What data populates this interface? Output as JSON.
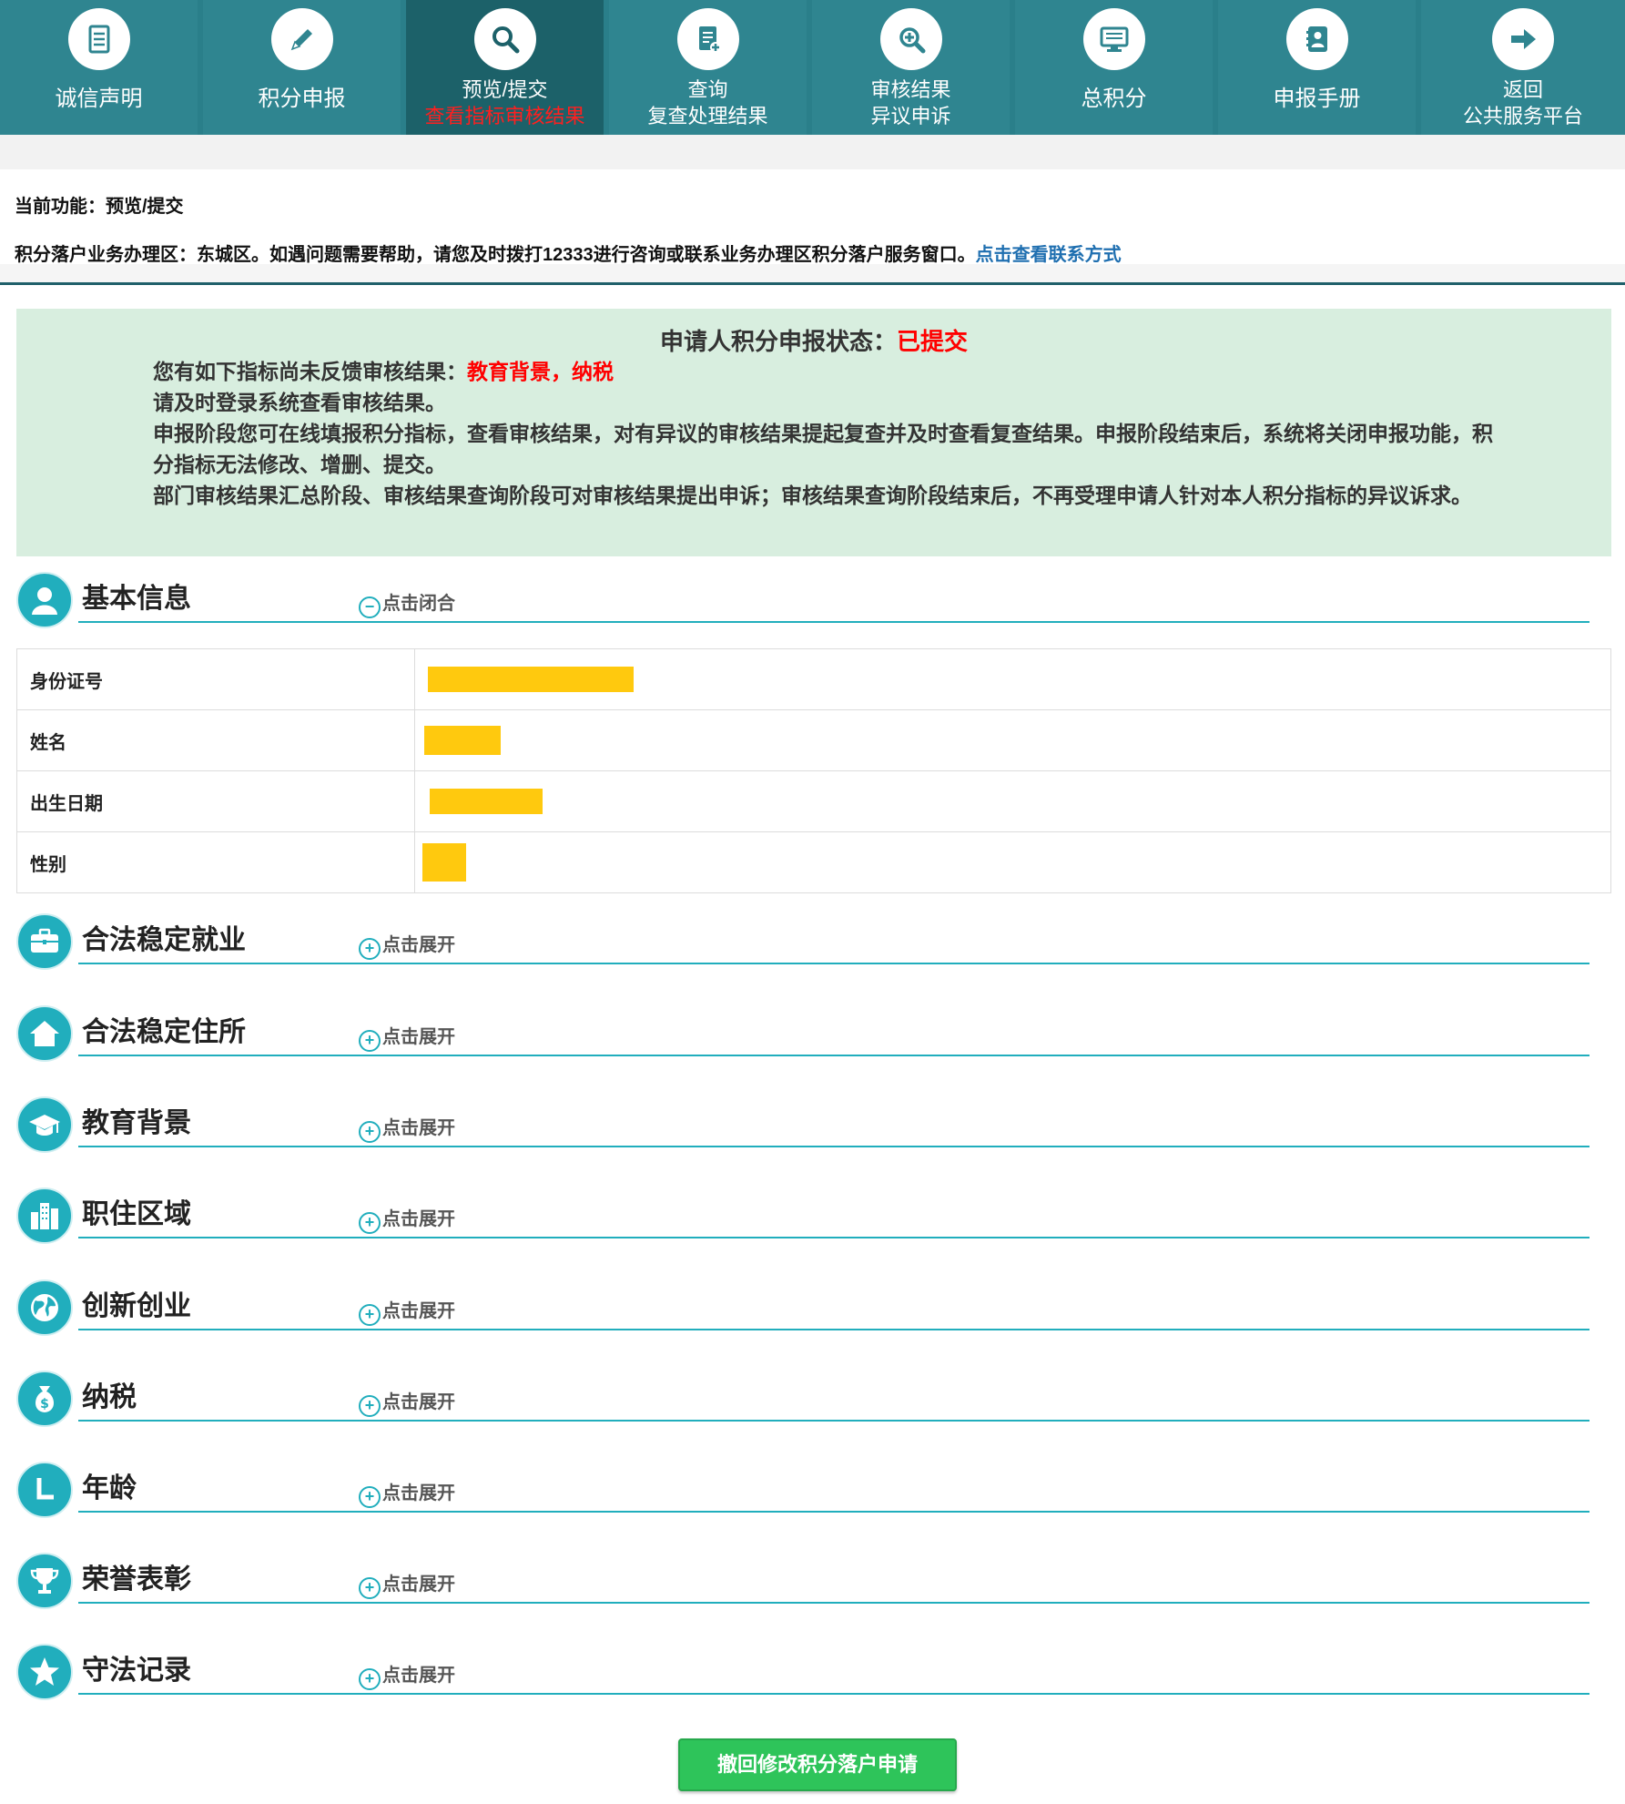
{
  "nav": {
    "items": [
      {
        "label": "诚信声明",
        "label2": "",
        "icon": "document-icon"
      },
      {
        "label": "积分申报",
        "label2": "",
        "icon": "pencil-icon"
      },
      {
        "label": "预览/提交",
        "label2": "查看指标审核结果",
        "icon": "search-icon"
      },
      {
        "label": "查询",
        "label2": "复查处理结果",
        "icon": "document-add-icon"
      },
      {
        "label": "审核结果",
        "label2": "异议申诉",
        "icon": "zoom-in-icon"
      },
      {
        "label": "总积分",
        "label2": "",
        "icon": "monitor-icon"
      },
      {
        "label": "申报手册",
        "label2": "",
        "icon": "handbook-icon"
      },
      {
        "label": "返回",
        "label2": "公共服务平台",
        "icon": "arrow-right-icon"
      }
    ]
  },
  "info": {
    "current_function": "当前功能：预览/提交",
    "district_notice": "积分落户业务办理区：东城区。如遇问题需要帮助，请您及时拨打12333进行咨询或联系业务办理区积分落户服务窗口。",
    "contact_link": "点击查看联系方式"
  },
  "status": {
    "title_prefix": "申请人积分申报状态：",
    "title_value": "已提交",
    "line1_prefix": "您有如下指标尚未反馈审核结果：",
    "line1_value": "教育背景，纳税",
    "line2": "请及时登录系统查看审核结果。",
    "line3": "申报阶段您可在线填报积分指标，查看审核结果，对有异议的审核结果提起复查并及时查看复查结果。申报阶段结束后，系统将关闭申报功能，积分指标无法修改、增删、提交。",
    "line4": "部门审核结果汇总阶段、审核结果查询阶段可对审核结果提出申诉；审核结果查询阶段结束后，不再受理申请人针对本人积分指标的异议诉求。"
  },
  "basic": {
    "title": "基本信息",
    "toggle": "点击闭合",
    "rows": [
      {
        "label": "身份证号"
      },
      {
        "label": "姓名"
      },
      {
        "label": "出生日期"
      },
      {
        "label": "性别"
      }
    ]
  },
  "sections": [
    {
      "title": "合法稳定就业",
      "toggle": "点击展开",
      "icon": "briefcase-icon"
    },
    {
      "title": "合法稳定住所",
      "toggle": "点击展开",
      "icon": "house-icon"
    },
    {
      "title": "教育背景",
      "toggle": "点击展开",
      "icon": "graduation-cap-icon"
    },
    {
      "title": "职住区域",
      "toggle": "点击展开",
      "icon": "city-buildings-icon"
    },
    {
      "title": "创新创业",
      "toggle": "点击展开",
      "icon": "globe-icon"
    },
    {
      "title": "纳税",
      "toggle": "点击展开",
      "icon": "money-bag-icon"
    },
    {
      "title": "年龄",
      "toggle": "点击展开",
      "icon": "clock-icon"
    },
    {
      "title": "荣誉表彰",
      "toggle": "点击展开",
      "icon": "trophy-icon"
    },
    {
      "title": "守法记录",
      "toggle": "点击展开",
      "icon": "star-icon"
    }
  ],
  "withdraw_button": "撤回修改积分落户申请",
  "colors": {
    "nav_bg": "#2f8590",
    "nav_active_bg": "#1c6169",
    "accent": "#21aebd",
    "alert_red": "#ff0000",
    "status_panel_bg": "#d8eedf",
    "button_green": "#2ec45a",
    "redaction_yellow": "#ffc90e"
  }
}
